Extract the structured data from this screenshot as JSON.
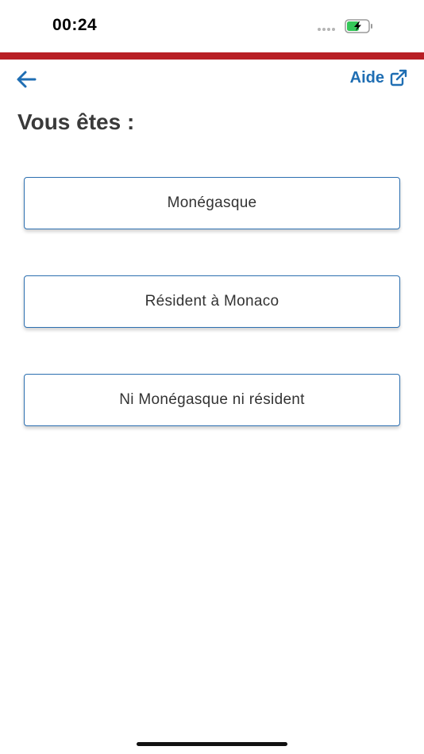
{
  "status_bar": {
    "time": "00:24"
  },
  "nav": {
    "back_icon": "arrow-left-icon",
    "help_label": "Aide",
    "help_icon": "external-link-icon"
  },
  "page": {
    "title": "Vous êtes :"
  },
  "options": [
    {
      "label": "Monégasque"
    },
    {
      "label": "Résident à Monaco"
    },
    {
      "label": "Ni Monégasque ni résident"
    }
  ],
  "colors": {
    "brand_red": "#b81f25",
    "link_blue": "#1f6eb3",
    "button_border": "#2c6fb0",
    "battery_green": "#34c759"
  }
}
